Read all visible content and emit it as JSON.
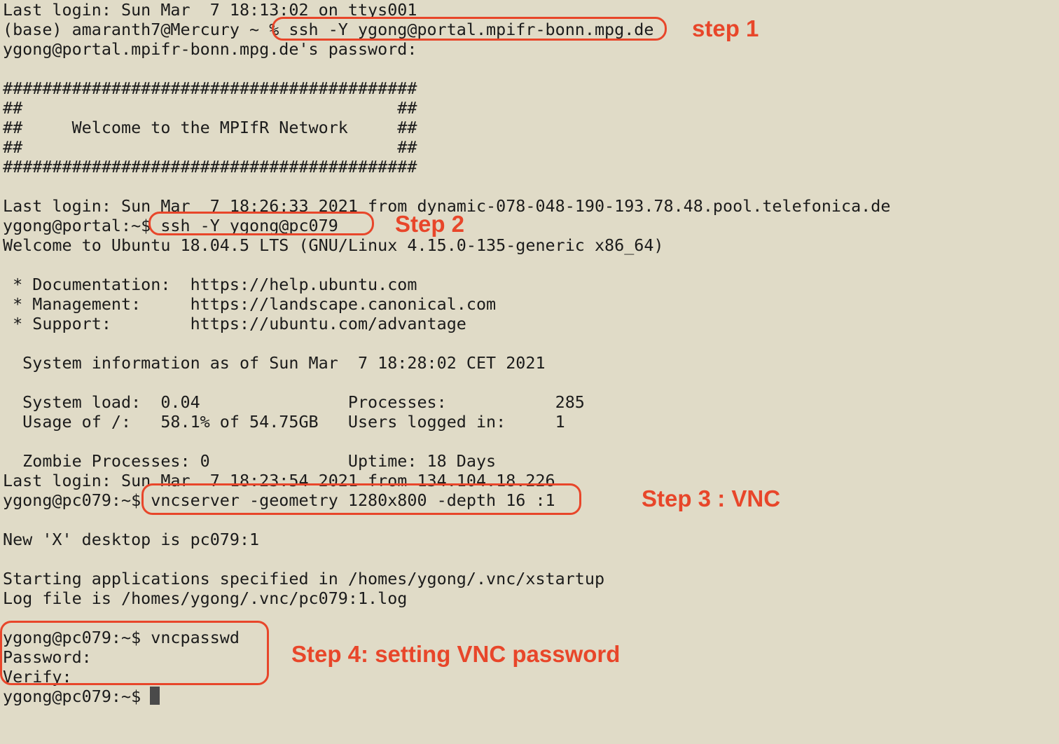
{
  "terminal": {
    "lines": [
      "Last login: Sun Mar  7 18:13:02 on ttys001",
      "(base) amaranth7@Mercury ~ % ssh -Y ygong@portal.mpifr-bonn.mpg.de",
      "ygong@portal.mpifr-bonn.mpg.de's password:",
      "",
      "##########################################",
      "##                                      ##",
      "##     Welcome to the MPIfR Network     ##",
      "##                                      ##",
      "##########################################",
      "",
      "Last login: Sun Mar  7 18:26:33 2021 from dynamic-078-048-190-193.78.48.pool.telefonica.de",
      "ygong@portal:~$ ssh -Y ygong@pc079",
      "Welcome to Ubuntu 18.04.5 LTS (GNU/Linux 4.15.0-135-generic x86_64)",
      "",
      " * Documentation:  https://help.ubuntu.com",
      " * Management:     https://landscape.canonical.com",
      " * Support:        https://ubuntu.com/advantage",
      "",
      "  System information as of Sun Mar  7 18:28:02 CET 2021",
      "",
      "  System load:  0.04               Processes:           285",
      "  Usage of /:   58.1% of 54.75GB   Users logged in:     1",
      "",
      "  Zombie Processes: 0              Uptime: 18 Days",
      "Last login: Sun Mar  7 18:23:54 2021 from 134.104.18.226",
      "ygong@pc079:~$ vncserver -geometry 1280x800 -depth 16 :1",
      "",
      "New 'X' desktop is pc079:1",
      "",
      "Starting applications specified in /homes/ygong/.vnc/xstartup",
      "Log file is /homes/ygong/.vnc/pc079:1.log",
      "",
      "ygong@pc079:~$ vncpasswd",
      "Password:",
      "Verify:",
      "ygong@pc079:~$ "
    ]
  },
  "annotations": {
    "color": "#e8462a",
    "step1": "step 1",
    "step2": "Step 2",
    "step3": "Step 3 : VNC",
    "step4": "Step 4: setting VNC password"
  },
  "colors": {
    "background": "#e0dbc7",
    "text": "#1b1b1b",
    "cursor": "#4a4a4a"
  }
}
